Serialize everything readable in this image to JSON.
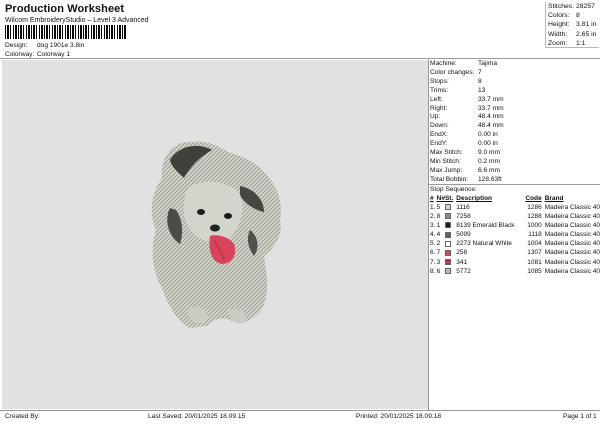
{
  "header": {
    "title": "Production Worksheet",
    "subtitle": "Wilcom EmbroideryStudio – Level 3 Advanced",
    "design_label": "Design:",
    "design_value": "dog 1901e 3.8in",
    "colorway_label": "Colorway:",
    "colorway_value": "Colorway 1"
  },
  "summary": [
    {
      "label": "Stitches:",
      "value": "28257"
    },
    {
      "label": "Colors:",
      "value": "8"
    },
    {
      "label": "Height:",
      "value": "3.81 in"
    },
    {
      "label": "Width:",
      "value": "2.65 in"
    },
    {
      "label": "Zoom:",
      "value": "1:1"
    }
  ],
  "machine_info": [
    {
      "label": "Machine:",
      "value": "Tajima"
    },
    {
      "label": "Color changes:",
      "value": "7"
    },
    {
      "label": "Stops:",
      "value": "8"
    },
    {
      "label": "Trims:",
      "value": "13"
    },
    {
      "label": "Left:",
      "value": "33.7 mm"
    },
    {
      "label": "Right:",
      "value": "33.7 mm"
    },
    {
      "label": "Up:",
      "value": "48.4 mm"
    },
    {
      "label": "Down:",
      "value": "48.4 mm"
    },
    {
      "label": "EndX:",
      "value": "0.00 in"
    },
    {
      "label": "EndY:",
      "value": "0.00 in"
    },
    {
      "label": "Max Stitch:",
      "value": "9.0 mm"
    },
    {
      "label": "Min Stitch:",
      "value": "0.2 mm"
    },
    {
      "label": "Max Jump:",
      "value": "6.6 mm"
    },
    {
      "label": "Total Bobbin:",
      "value": "128.63ft"
    }
  ],
  "stop_sequence": {
    "title": "Stop Sequence:",
    "headers": [
      "#",
      "N#",
      "St.",
      "Description",
      "Code",
      "Brand"
    ],
    "rows": [
      {
        "idx": "1.",
        "n": "5",
        "color": "#d2d6c9",
        "code": "1116",
        "desc": "",
        "stitches": "1286",
        "brand": "Madeira Classic 40"
      },
      {
        "idx": "2.",
        "n": "8",
        "color": "#8b8f86",
        "code": "7258",
        "desc": "",
        "stitches": "1288",
        "brand": "Madeira Classic 40"
      },
      {
        "idx": "3.",
        "n": "1",
        "color": "#1a1a1a",
        "code": "8139",
        "desc": "Emerald Black",
        "stitches": "1000",
        "brand": "Madeira Classic 40"
      },
      {
        "idx": "4.",
        "n": "4",
        "color": "#5d605c",
        "code": "5099",
        "desc": "",
        "stitches": "1118",
        "brand": "Madeira Classic 40"
      },
      {
        "idx": "5.",
        "n": "2",
        "color": "#ffffff",
        "code": "2273",
        "desc": "Natural White",
        "stitches": "1004",
        "brand": "Madeira Classic 40"
      },
      {
        "idx": "6.",
        "n": "7",
        "color": "#d9435c",
        "code": "258",
        "desc": "",
        "stitches": "1307",
        "brand": "Madeira Classic 40"
      },
      {
        "idx": "7.",
        "n": "3",
        "color": "#b8334b",
        "code": "341",
        "desc": "",
        "stitches": "1081",
        "brand": "Madeira Classic 40"
      },
      {
        "idx": "8.",
        "n": "6",
        "color": "#c9b3b3",
        "code": "5772",
        "desc": "",
        "stitches": "1085",
        "brand": "Madeira Classic 40"
      }
    ]
  },
  "footer": {
    "created_by": "Created By:",
    "last_saved": "Last Saved: 20/01/2025 18.09.15",
    "printed": "Printed: 20/01/2025 18.09.18",
    "page": "Page 1 of 1"
  }
}
